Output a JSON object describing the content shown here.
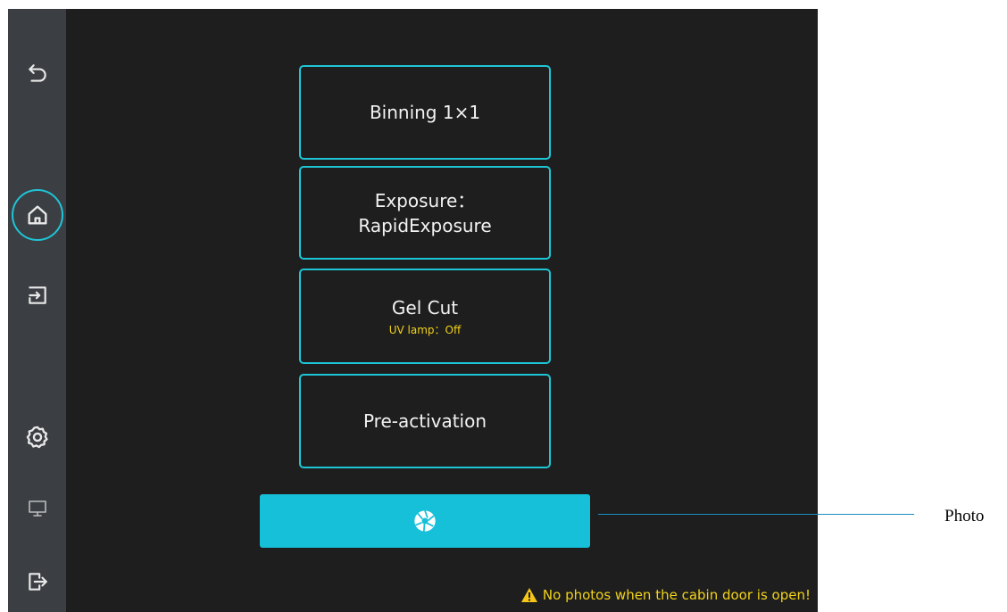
{
  "sidebar": {
    "items": [
      {
        "name": "back",
        "icon": "back-arrow-icon"
      },
      {
        "name": "home",
        "icon": "home-icon",
        "active": true
      },
      {
        "name": "import",
        "icon": "import-icon"
      },
      {
        "name": "settings",
        "icon": "gear-icon"
      },
      {
        "name": "display",
        "icon": "monitor-icon"
      },
      {
        "name": "exit",
        "icon": "exit-icon"
      }
    ]
  },
  "options": {
    "binning": {
      "label": "Binning 1×1"
    },
    "exposure": {
      "line1": "Exposure：",
      "line2": "RapidExposure"
    },
    "gelcut": {
      "label": "Gel Cut",
      "status": "UV lamp：Off"
    },
    "preactivation": {
      "label": "Pre-activation"
    }
  },
  "photo_button": {
    "icon": "camera-shutter-icon"
  },
  "warning": {
    "text": "No photos when the cabin door is open!",
    "icon": "warning-triangle-icon"
  },
  "annotation": {
    "label": "Photo"
  },
  "colors": {
    "accent": "#1ec5d6",
    "background": "#1e1e1e",
    "sidebar": "#3b3e43",
    "warning": "#f2d21a",
    "photo_button": "#16c0d8"
  }
}
